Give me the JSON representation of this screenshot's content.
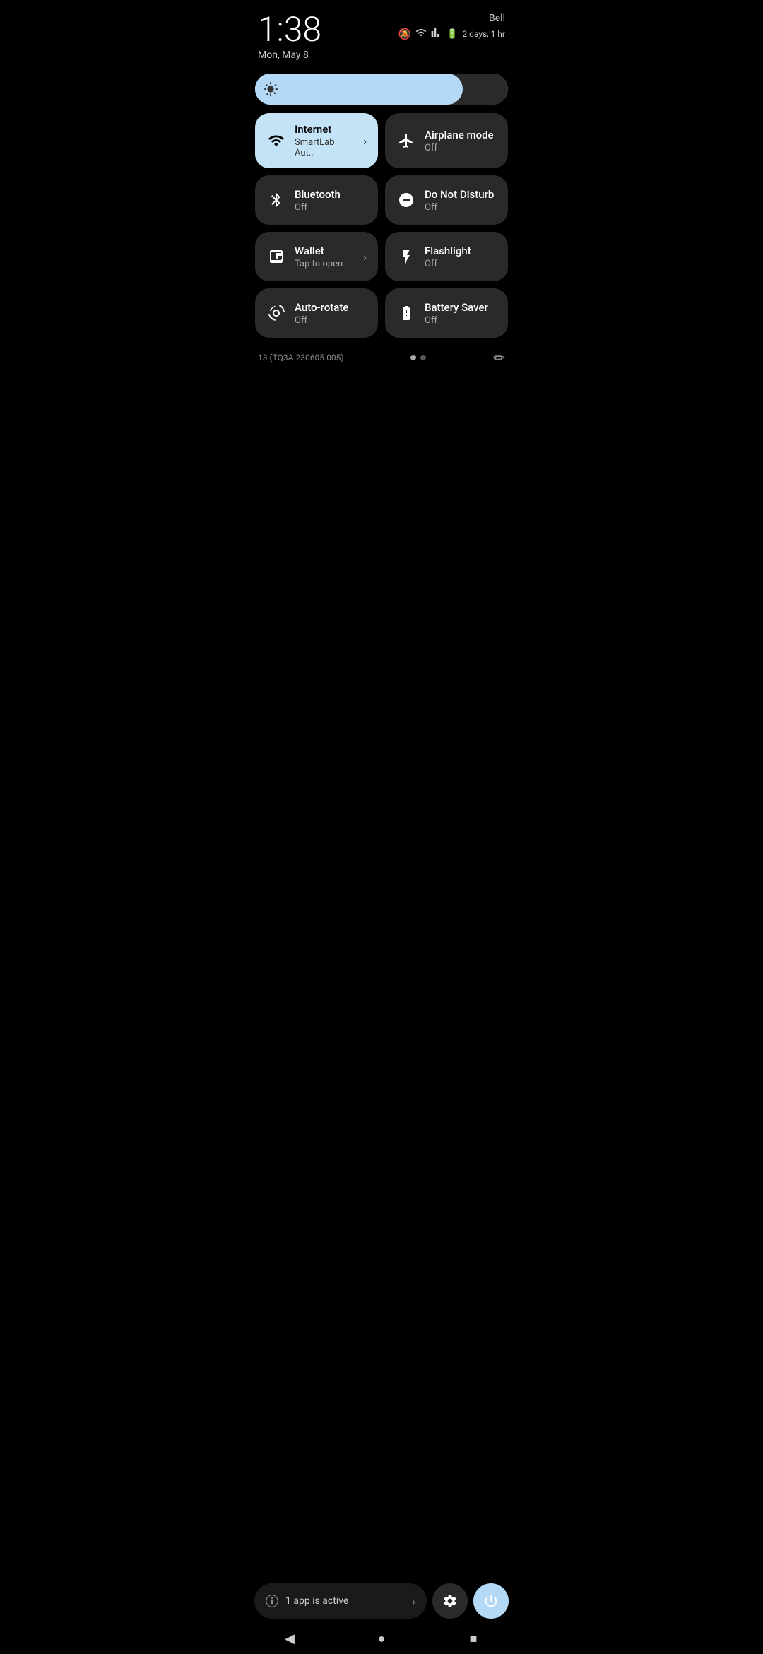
{
  "statusBar": {
    "time": "1:38",
    "date": "Mon, May 8",
    "carrier": "Bell",
    "battery": "2 days, 1 hr"
  },
  "brightness": {
    "level": 82
  },
  "tiles": [
    {
      "id": "internet",
      "label": "Internet",
      "sublabel": "SmartLab Aut..",
      "active": true,
      "hasChevron": true,
      "icon": "wifi"
    },
    {
      "id": "airplane",
      "label": "Airplane mode",
      "sublabel": "Off",
      "active": false,
      "hasChevron": false,
      "icon": "airplane"
    },
    {
      "id": "bluetooth",
      "label": "Bluetooth",
      "sublabel": "Off",
      "active": false,
      "hasChevron": false,
      "icon": "bluetooth"
    },
    {
      "id": "dnd",
      "label": "Do Not Disturb",
      "sublabel": "Off",
      "active": false,
      "hasChevron": false,
      "icon": "dnd"
    },
    {
      "id": "wallet",
      "label": "Wallet",
      "sublabel": "Tap to open",
      "active": false,
      "hasChevron": true,
      "icon": "wallet"
    },
    {
      "id": "flashlight",
      "label": "Flashlight",
      "sublabel": "Off",
      "active": false,
      "hasChevron": false,
      "icon": "flashlight"
    },
    {
      "id": "autorotate",
      "label": "Auto-rotate",
      "sublabel": "Off",
      "active": false,
      "hasChevron": false,
      "icon": "autorotate"
    },
    {
      "id": "batterysaver",
      "label": "Battery Saver",
      "sublabel": "Off",
      "active": false,
      "hasChevron": false,
      "icon": "batterysaver"
    }
  ],
  "footer": {
    "buildNumber": "13 (TQ3A.230605.005)",
    "editLabel": "✏"
  },
  "bottomBar": {
    "activeAppLabel": "1 app is active"
  },
  "navBar": {
    "back": "◀",
    "home": "●",
    "recents": "■"
  }
}
